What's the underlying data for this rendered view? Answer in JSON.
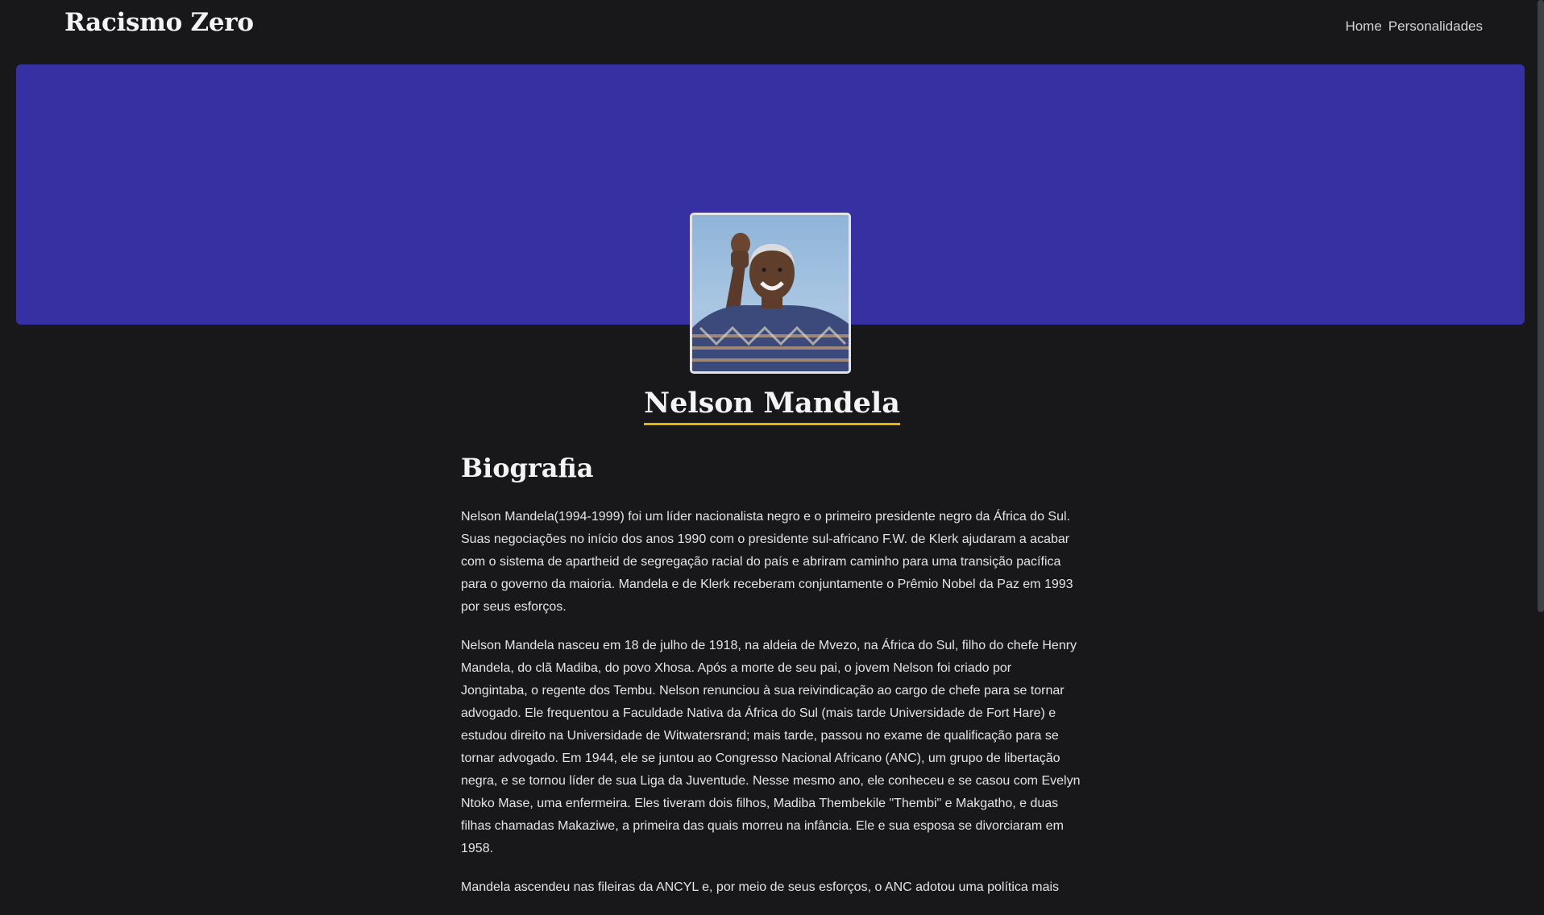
{
  "navbar": {
    "brand": "Racismo Zero",
    "links": [
      {
        "label": "Home"
      },
      {
        "label": "Personalidades"
      }
    ]
  },
  "colors": {
    "background": "#18181b",
    "hero": "#3730a3",
    "accent_underline": "#eab308"
  },
  "profile": {
    "name": "Nelson Mandela",
    "image_icon": "portrait-photo"
  },
  "biography": {
    "title": "Biografia",
    "paragraphs": [
      "Nelson Mandela(1994-1999) foi um líder nacionalista negro e o primeiro presidente negro da África do Sul. Suas negociações no início dos anos 1990 com o presidente sul-africano F.W. de Klerk ajudaram a acabar com o sistema de apartheid de segregação racial do país e abriram caminho para uma transição pacífica para o governo da maioria. Mandela e de Klerk receberam conjuntamente o Prêmio Nobel da Paz em 1993 por seus esforços.",
      "Nelson Mandela nasceu em 18 de julho de 1918, na aldeia de Mvezo, na África do Sul, filho do chefe Henry Mandela, do clã Madiba, do povo Xhosa. Após a morte de seu pai, o jovem Nelson foi criado por Jongintaba, o regente dos Tembu. Nelson renunciou à sua reivindicação ao cargo de chefe para se tornar advogado. Ele frequentou a Faculdade Nativa da África do Sul (mais tarde Universidade de Fort Hare) e estudou direito na Universidade de Witwatersrand; mais tarde, passou no exame de qualificação para se tornar advogado. Em 1944, ele se juntou ao Congresso Nacional Africano (ANC), um grupo de libertação negra, e se tornou líder de sua Liga da Juventude. Nesse mesmo ano, ele conheceu e se casou com Evelyn Ntoko Mase, uma enfermeira. Eles tiveram dois filhos, Madiba Thembekile \"Thembi\" e Makgatho, e duas filhas chamadas Makaziwe, a primeira das quais morreu na infância. Ele e sua esposa se divorciaram em 1958.",
      "Mandela ascendeu nas fileiras da ANCYL e, por meio de seus esforços, o ANC adotou uma política mais"
    ]
  }
}
